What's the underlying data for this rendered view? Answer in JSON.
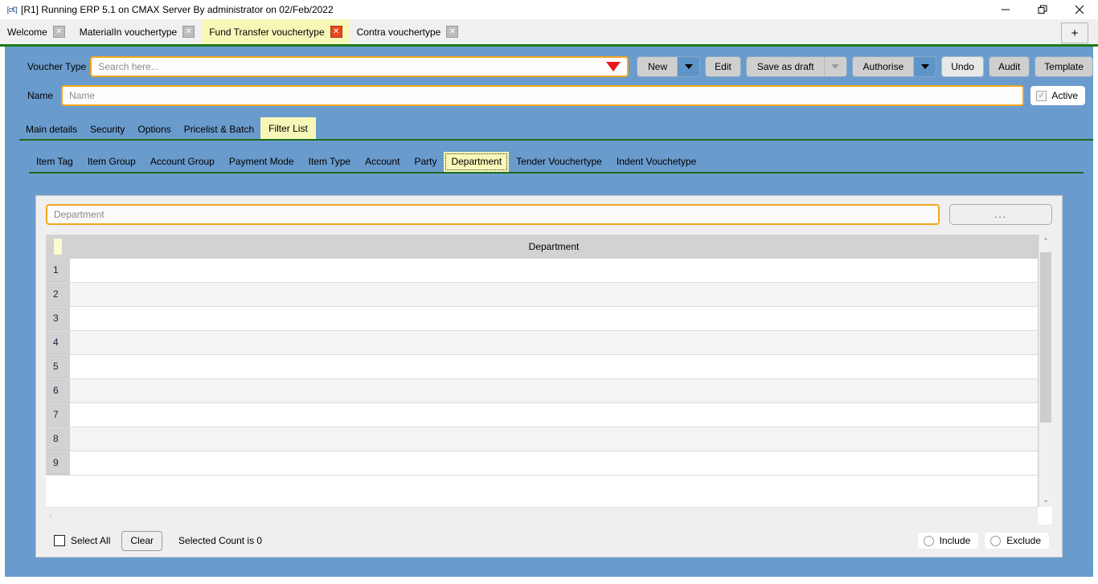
{
  "window": {
    "app_icon": "app-icon",
    "title": "[R1] Running ERP 5.1 on CMAX Server By administrator on 02/Feb/2022",
    "minimize_label": "minimize-icon",
    "maximize_label": "restore-icon",
    "close_label": "close-icon"
  },
  "tabstrip": {
    "tabs": [
      {
        "label": "Welcome",
        "active": false,
        "close": "✕"
      },
      {
        "label": "MaterialIn vouchertype",
        "active": false,
        "close": "✕"
      },
      {
        "label": "Fund Transfer vouchertype",
        "active": true,
        "close": "✕"
      },
      {
        "label": "Contra vouchertype",
        "active": false,
        "close": "✕"
      }
    ],
    "new_tab_label": "+"
  },
  "form": {
    "voucher_type_label": "Voucher Type",
    "search_placeholder": "Search here...",
    "search_value": "",
    "name_label": "Name",
    "name_placeholder": "Name",
    "name_value": "",
    "active_label": "Active",
    "active_checked": true,
    "active_mark": "✓"
  },
  "toolbar": {
    "new_label": "New",
    "edit_label": "Edit",
    "save_as_draft_label": "Save as draft",
    "authorise_label": "Authorise",
    "undo_label": "Undo",
    "audit_label": "Audit",
    "template_label": "Template"
  },
  "tabs_level1": [
    {
      "label": "Main details",
      "selected": false
    },
    {
      "label": "Security",
      "selected": false
    },
    {
      "label": "Options",
      "selected": false
    },
    {
      "label": "Pricelist & Batch",
      "selected": false
    },
    {
      "label": "Filter List",
      "selected": true
    }
  ],
  "tabs_level2": [
    {
      "label": "Item Tag",
      "selected": false
    },
    {
      "label": "Item Group",
      "selected": false
    },
    {
      "label": "Account Group",
      "selected": false
    },
    {
      "label": "Payment Mode",
      "selected": false
    },
    {
      "label": "Item Type",
      "selected": false
    },
    {
      "label": "Account",
      "selected": false
    },
    {
      "label": "Party",
      "selected": false
    },
    {
      "label": "Department",
      "selected": true
    },
    {
      "label": "Tender Vouchertype",
      "selected": false
    },
    {
      "label": "Indent Vouchetype",
      "selected": false
    }
  ],
  "panel": {
    "filter_placeholder": "Department",
    "filter_value": "",
    "browse_label": "...",
    "grid": {
      "column_header": "Department",
      "rows": [
        {
          "num": "1",
          "value": ""
        },
        {
          "num": "2",
          "value": ""
        },
        {
          "num": "3",
          "value": ""
        },
        {
          "num": "4",
          "value": ""
        },
        {
          "num": "5",
          "value": ""
        },
        {
          "num": "6",
          "value": ""
        },
        {
          "num": "7",
          "value": ""
        },
        {
          "num": "8",
          "value": ""
        },
        {
          "num": "9",
          "value": ""
        }
      ]
    },
    "scroll": {
      "up_arrow": "⌃",
      "down_arrow": "⌄",
      "left_arrow": "‹",
      "right_arrow": "›"
    },
    "footer": {
      "select_all_label": "Select All",
      "select_all_checked": false,
      "clear_label": "Clear",
      "selected_count_text": "Selected Count is 0",
      "include_label": "Include",
      "exclude_label": "Exclude",
      "include_selected": false,
      "exclude_selected": false
    }
  },
  "colors": {
    "app_background": "#6a9bcd",
    "accent_border": "#f0a81e",
    "active_tab": "#f7f7b8",
    "close_active": "#e8491f",
    "tab_underline": "#1a6b1a",
    "dropdown_arrow": "#e8191a"
  }
}
